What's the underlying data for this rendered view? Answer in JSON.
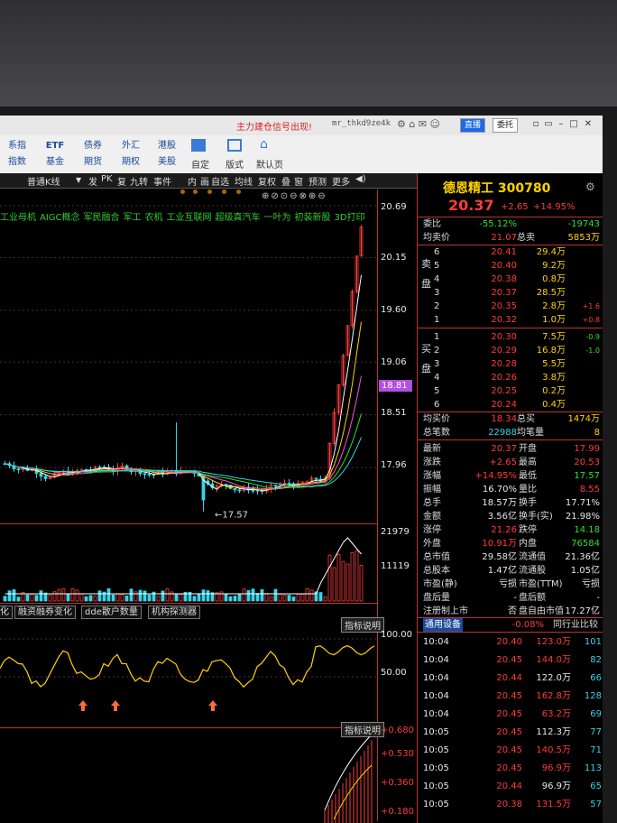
{
  "title_bar": {
    "message": "主力建仓信号出现!",
    "user": "mr_thkd9ze4k",
    "btn_direct": "直播",
    "btn_entrust": "委托"
  },
  "toolbar": {
    "row1": [
      "系指",
      "ETF",
      "债券",
      "外汇",
      "港股"
    ],
    "row2": [
      "指数",
      "基金",
      "期货",
      "期权",
      "美股"
    ],
    "custom": "自定",
    "layout": "版式",
    "default": "默认页"
  },
  "menubar": {
    "period": "普通K线",
    "items": [
      "发",
      "PK",
      "复",
      "九转",
      "事件",
      "内",
      "画",
      "自选",
      "均线",
      "复权",
      "叠",
      "窗",
      "预测",
      "更多"
    ]
  },
  "chart": {
    "concept_tags": [
      "工业母机",
      "AIGC概念",
      "军民融合",
      "军工",
      "农机",
      "工业互联网",
      "超级真汽车",
      "一叶为",
      "初装新股",
      "3D打印"
    ],
    "min_label": "17.57",
    "tabs": [
      "化",
      "融资融券变化",
      "dde散户数量",
      "机构探测器"
    ],
    "indicator_btn": "指标说明"
  },
  "chart_data": [
    {
      "type": "candlestick",
      "ylabel": "",
      "y_ticks": [
        20.69,
        20.15,
        19.6,
        19.06,
        18.51,
        17.96
      ],
      "current_marker": "18.81",
      "min_label": 17.57,
      "up_color": "#ff3b3b",
      "down_color": "#39d4e8"
    },
    {
      "type": "bar",
      "y_ticks": [
        21979,
        11119
      ]
    },
    {
      "type": "line",
      "y_ticks": [
        100.0,
        50.0
      ],
      "colors": [
        "#ffd400"
      ]
    },
    {
      "type": "line",
      "y_ticks": [
        0.682,
        0.534,
        0.357,
        0.18
      ]
    }
  ],
  "quote": {
    "name": "德恩精工",
    "code": "300780",
    "price": "20.37",
    "change": "+2.65",
    "change_pct": "+14.95%",
    "weibi_label": "委比",
    "weibi": "-55.12%",
    "weibi_diff": "-19743",
    "avg_sell_label": "均卖价",
    "avg_sell": "21.07",
    "total_sell_label": "总卖",
    "total_sell": "5853万",
    "sell_side_label": "卖盘",
    "sells": [
      {
        "n": "6",
        "p": "20.41",
        "v": "29.4万",
        "c": ""
      },
      {
        "n": "5",
        "p": "20.40",
        "v": "9.2万",
        "c": ""
      },
      {
        "n": "4",
        "p": "20.38",
        "v": "0.8万",
        "c": ""
      },
      {
        "n": "3",
        "p": "20.37",
        "v": "28.5万",
        "c": ""
      },
      {
        "n": "2",
        "p": "20.35",
        "v": "2.8万",
        "c": "+1.6"
      },
      {
        "n": "1",
        "p": "20.32",
        "v": "1.0万",
        "c": "+0.8"
      }
    ],
    "buy_side_label": "买盘",
    "buys": [
      {
        "n": "1",
        "p": "20.30",
        "v": "7.5万",
        "c": "-0.9"
      },
      {
        "n": "2",
        "p": "20.29",
        "v": "16.8万",
        "c": "-1.0"
      },
      {
        "n": "3",
        "p": "20.28",
        "v": "5.5万",
        "c": ""
      },
      {
        "n": "4",
        "p": "20.26",
        "v": "3.8万",
        "c": ""
      },
      {
        "n": "5",
        "p": "20.25",
        "v": "0.2万",
        "c": ""
      },
      {
        "n": "6",
        "p": "20.24",
        "v": "0.4万",
        "c": ""
      }
    ],
    "avg_buy_label": "均买价",
    "avg_buy": "18.34",
    "total_buy_label": "总买",
    "total_buy": "1474万",
    "total_deals_label": "总笔数",
    "total_deals": "22988",
    "avg_per_deal_label": "均笔量",
    "avg_per_deal": "8",
    "stats": [
      {
        "l1": "最新",
        "v1": "20.37",
        "c1": "red",
        "l2": "开盘",
        "v2": "17.99",
        "c2": "red"
      },
      {
        "l1": "涨跌",
        "v1": "+2.65",
        "c1": "red",
        "l2": "最高",
        "v2": "20.53",
        "c2": "red"
      },
      {
        "l1": "涨幅",
        "v1": "+14.95%",
        "c1": "red",
        "l2": "最低",
        "v2": "17.57",
        "c2": "grn"
      },
      {
        "l1": "振幅",
        "v1": "16.70%",
        "c1": "wht",
        "l2": "量比",
        "v2": "8.55",
        "c2": "red"
      },
      {
        "l1": "总手",
        "v1": "18.57万",
        "c1": "wht",
        "l2": "换手",
        "v2": "17.71%",
        "c2": "wht"
      },
      {
        "l1": "金额",
        "v1": "3.56亿",
        "c1": "wht",
        "l2": "换手(实)",
        "v2": "21.98%",
        "c2": "wht"
      },
      {
        "l1": "涨停",
        "v1": "21.26",
        "c1": "red",
        "l2": "跌停",
        "v2": "14.18",
        "c2": "grn"
      },
      {
        "l1": "外盘",
        "v1": "10.91万",
        "c1": "red",
        "l2": "内盘",
        "v2": "76584",
        "c2": "grn"
      },
      {
        "l1": "总市值",
        "v1": "29.58亿",
        "c1": "wht",
        "l2": "流通值",
        "v2": "21.36亿",
        "c2": "wht"
      },
      {
        "l1": "总股本",
        "v1": "1.47亿",
        "c1": "wht",
        "l2": "流通股",
        "v2": "1.05亿",
        "c2": "wht"
      },
      {
        "l1": "市盈(静)",
        "v1": "亏损",
        "c1": "wht",
        "l2": "市盈(TTM)",
        "v2": "亏损",
        "c2": "wht"
      },
      {
        "l1": "盘后量",
        "v1": "-",
        "c1": "wht",
        "l2": "盘后额",
        "v2": "-",
        "c2": "wht"
      },
      {
        "l1": "注册制上市",
        "v1": "否",
        "c1": "wht",
        "l2": "盘自由市值",
        "v2": "17.27亿",
        "c2": "wht"
      }
    ],
    "sector_label": "通用设备",
    "sector_change": "-0.08%",
    "sector_compare": "同行业比较",
    "ticks": [
      {
        "t": "10:04",
        "p": "20.40",
        "v": "123.0万",
        "n": "101"
      },
      {
        "t": "10:04",
        "p": "20.45",
        "v": "144.0万",
        "n": "82"
      },
      {
        "t": "10:04",
        "p": "20.44",
        "v": "122.0万",
        "n": "66"
      },
      {
        "t": "10:04",
        "p": "20.45",
        "v": "162.8万",
        "n": "128"
      },
      {
        "t": "10:04",
        "p": "20.45",
        "v": "63.2万",
        "n": "69"
      },
      {
        "t": "10:05",
        "p": "20.45",
        "v": "112.3万",
        "n": "77"
      },
      {
        "t": "10:05",
        "p": "20.45",
        "v": "140.5万",
        "n": "71"
      },
      {
        "t": "10:05",
        "p": "20.45",
        "v": "96.9万",
        "n": "113"
      },
      {
        "t": "10:05",
        "p": "20.44",
        "v": "96.9万",
        "n": "65"
      },
      {
        "t": "10:05",
        "p": "20.38",
        "v": "131.5万",
        "n": "57"
      }
    ]
  }
}
